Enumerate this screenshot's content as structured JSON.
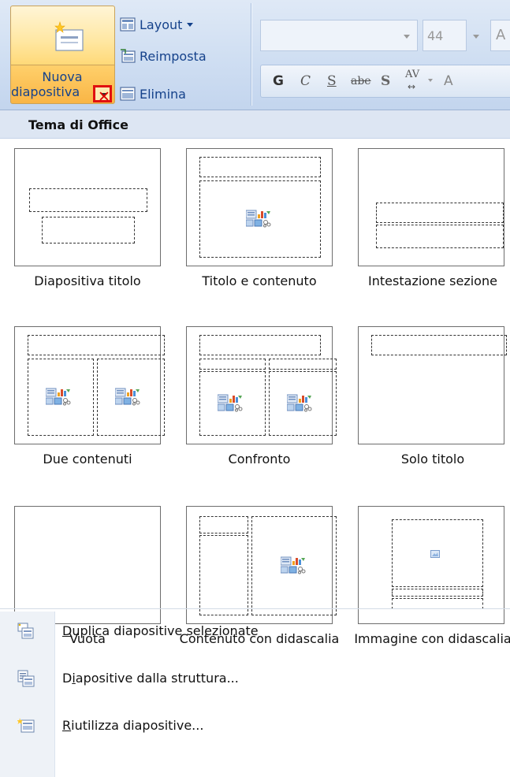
{
  "ribbon": {
    "new_slide_line1": "Nuova",
    "new_slide_line2": "diapositiva",
    "layout_label": "Layout",
    "reset_label": "Reimposta",
    "delete_label": "Elimina",
    "font_size_value": "44",
    "grow_font_glyph": "A",
    "bold_glyph": "G",
    "italic_glyph": "C",
    "underline_glyph": "S",
    "strike_glyph": "abe",
    "shadow_glyph": "S",
    "spacing_glyph": "AV",
    "spacing_arrow": "↔",
    "extra_glyph": "A"
  },
  "menu": {
    "header": "Tema di Office",
    "layouts": [
      {
        "label": "Diapositiva titolo",
        "icon": "title-slide-layout"
      },
      {
        "label": "Titolo e contenuto",
        "icon": "title-content-layout"
      },
      {
        "label": "Intestazione sezione",
        "icon": "section-header-layout"
      },
      {
        "label": "Due contenuti",
        "icon": "two-content-layout"
      },
      {
        "label": "Confronto",
        "icon": "comparison-layout"
      },
      {
        "label": "Solo titolo",
        "icon": "title-only-layout"
      },
      {
        "label": "Vuota",
        "icon": "blank-layout"
      },
      {
        "label": "Contenuto con didascalia",
        "icon": "content-caption-layout"
      },
      {
        "label": "Immagine con didascalia",
        "icon": "picture-caption-layout"
      }
    ],
    "commands": [
      {
        "label": "Duplica diapositive selezionate",
        "accel": "D",
        "rest": "uplica diapositive selezionate",
        "icon": "duplicate-slides-icon"
      },
      {
        "label": "Diapositive dalla struttura...",
        "pre": "D",
        "accel": "i",
        "rest": "apositive dalla struttura...",
        "icon": "slides-from-outline-icon"
      },
      {
        "label": "Riutilizza diapositive...",
        "pre": "",
        "accel": "R",
        "rest": "iutilizza diapositive...",
        "icon": "reuse-slides-icon"
      }
    ]
  },
  "colors": {
    "ribbon_bg": "#cfdef2",
    "ribbon_text": "#15428b",
    "active_button": "#ffd978",
    "highlight_box": "#e01010",
    "menu_header_bg": "#dde6f3"
  }
}
